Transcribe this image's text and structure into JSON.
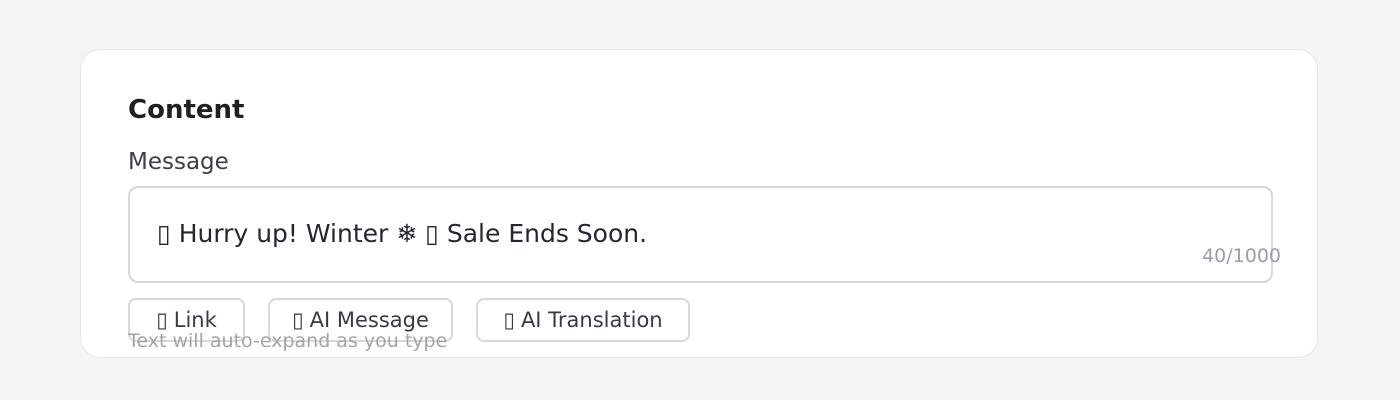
{
  "section": {
    "title": "Content"
  },
  "message": {
    "label": "Message",
    "value": "▯ Hurry up! Winter ❄ ▯ Sale Ends Soon.",
    "char_count": "40/1000"
  },
  "toolbar": {
    "link": {
      "icon": "▯",
      "label": "Link",
      "icon_name": "link-icon"
    },
    "ai_message": {
      "icon": "▯",
      "label": "AI Message",
      "icon_name": "sparkle-icon"
    },
    "ai_translation": {
      "icon": "▯",
      "label": "AI Translation",
      "icon_name": "translate-icon"
    }
  },
  "hint": "Text will auto-expand as you type"
}
